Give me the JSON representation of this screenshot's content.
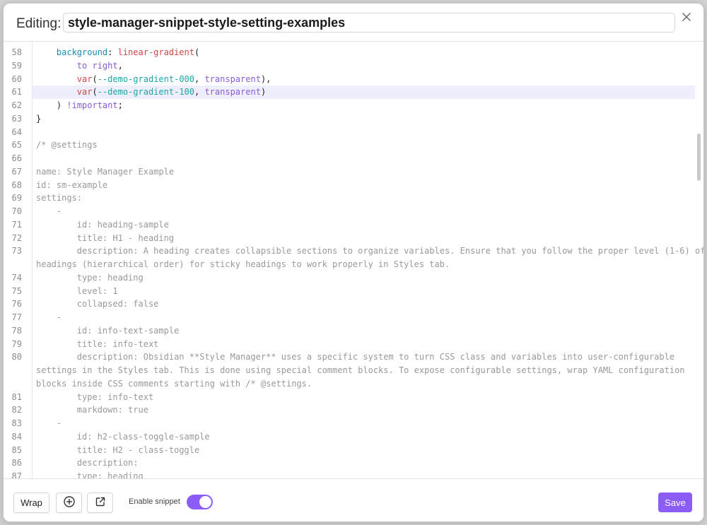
{
  "header": {
    "label": "Editing:",
    "snippet_name": "style-manager-snippet-style-setting-examples"
  },
  "editor": {
    "active_line": "61",
    "lines": [
      {
        "n": "58",
        "tokens": [
          [
            "p",
            "    "
          ],
          [
            "prop",
            "background"
          ],
          [
            "p",
            ": "
          ],
          [
            "fn",
            "linear-gradient"
          ],
          [
            "p",
            "("
          ]
        ]
      },
      {
        "n": "59",
        "tokens": [
          [
            "p",
            "        "
          ],
          [
            "kw",
            "to right"
          ],
          [
            "p",
            ","
          ]
        ]
      },
      {
        "n": "60",
        "tokens": [
          [
            "p",
            "        "
          ],
          [
            "fn",
            "var"
          ],
          [
            "p",
            "("
          ],
          [
            "var",
            "--demo-gradient-000"
          ],
          [
            "p",
            ", "
          ],
          [
            "kw",
            "transparent"
          ],
          [
            "p",
            "),"
          ]
        ]
      },
      {
        "n": "61",
        "tokens": [
          [
            "p",
            "        "
          ],
          [
            "fn",
            "var"
          ],
          [
            "p",
            "("
          ],
          [
            "var",
            "--demo-gradient-100"
          ],
          [
            "p",
            ", "
          ],
          [
            "kw",
            "transparent"
          ],
          [
            "p",
            ")"
          ]
        ]
      },
      {
        "n": "62",
        "tokens": [
          [
            "p",
            "    ) "
          ],
          [
            "kw",
            "!important"
          ],
          [
            "p",
            ";"
          ]
        ]
      },
      {
        "n": "63",
        "tokens": [
          [
            "p",
            "}"
          ]
        ]
      },
      {
        "n": "64",
        "tokens": []
      },
      {
        "n": "65",
        "tokens": [
          [
            "cm",
            "/* @settings"
          ]
        ]
      },
      {
        "n": "66",
        "tokens": []
      },
      {
        "n": "67",
        "tokens": [
          [
            "cm",
            "name: Style Manager Example"
          ]
        ]
      },
      {
        "n": "68",
        "tokens": [
          [
            "cm",
            "id: sm-example"
          ]
        ]
      },
      {
        "n": "69",
        "tokens": [
          [
            "cm",
            "settings:"
          ]
        ]
      },
      {
        "n": "70",
        "tokens": [
          [
            "cm",
            "    -"
          ]
        ]
      },
      {
        "n": "71",
        "tokens": [
          [
            "cm",
            "        id: heading-sample"
          ]
        ]
      },
      {
        "n": "72",
        "tokens": [
          [
            "cm",
            "        title: H1 - heading"
          ]
        ]
      },
      {
        "n": "73",
        "tokens": [
          [
            "cm",
            "        description: A heading creates collapsible sections to organize variables. Ensure that you follow the proper level (1-6) of"
          ]
        ]
      },
      {
        "n": "",
        "tokens": [
          [
            "cm",
            "headings (hierarchical order) for sticky headings to work properly in Styles tab."
          ]
        ]
      },
      {
        "n": "74",
        "tokens": [
          [
            "cm",
            "        type: heading"
          ]
        ]
      },
      {
        "n": "75",
        "tokens": [
          [
            "cm",
            "        level: 1"
          ]
        ]
      },
      {
        "n": "76",
        "tokens": [
          [
            "cm",
            "        collapsed: false"
          ]
        ]
      },
      {
        "n": "77",
        "tokens": [
          [
            "cm",
            "    -"
          ]
        ]
      },
      {
        "n": "78",
        "tokens": [
          [
            "cm",
            "        id: info-text-sample"
          ]
        ]
      },
      {
        "n": "79",
        "tokens": [
          [
            "cm",
            "        title: info-text"
          ]
        ]
      },
      {
        "n": "80",
        "tokens": [
          [
            "cm",
            "        description: Obsidian **Style Manager** uses a specific system to turn CSS class and variables into user-configurable"
          ]
        ]
      },
      {
        "n": "",
        "tokens": [
          [
            "cm",
            "settings in the Styles tab. This is done using special comment blocks. To expose configurable settings, wrap YAML configuration"
          ]
        ]
      },
      {
        "n": "",
        "tokens": [
          [
            "cm",
            "blocks inside CSS comments starting with /* @settings."
          ]
        ]
      },
      {
        "n": "81",
        "tokens": [
          [
            "cm",
            "        type: info-text"
          ]
        ]
      },
      {
        "n": "82",
        "tokens": [
          [
            "cm",
            "        markdown: true"
          ]
        ]
      },
      {
        "n": "83",
        "tokens": [
          [
            "cm",
            "    -"
          ]
        ]
      },
      {
        "n": "84",
        "tokens": [
          [
            "cm",
            "        id: h2-class-toggle-sample"
          ]
        ]
      },
      {
        "n": "85",
        "tokens": [
          [
            "cm",
            "        title: H2 - class-toggle"
          ]
        ]
      },
      {
        "n": "86",
        "tokens": [
          [
            "cm",
            "        description:"
          ]
        ]
      },
      {
        "n": "87",
        "tokens": [
          [
            "cm",
            "        type: heading"
          ]
        ]
      }
    ]
  },
  "footer": {
    "wrap_label": "Wrap",
    "add_icon": "plus-circle-icon",
    "open_icon": "external-link-icon",
    "toggle_label": "Enable snippet",
    "toggle_on": true,
    "save_label": "Save"
  },
  "colors": {
    "accent": "#8b5cf6",
    "active_line": "#eeeefc"
  }
}
